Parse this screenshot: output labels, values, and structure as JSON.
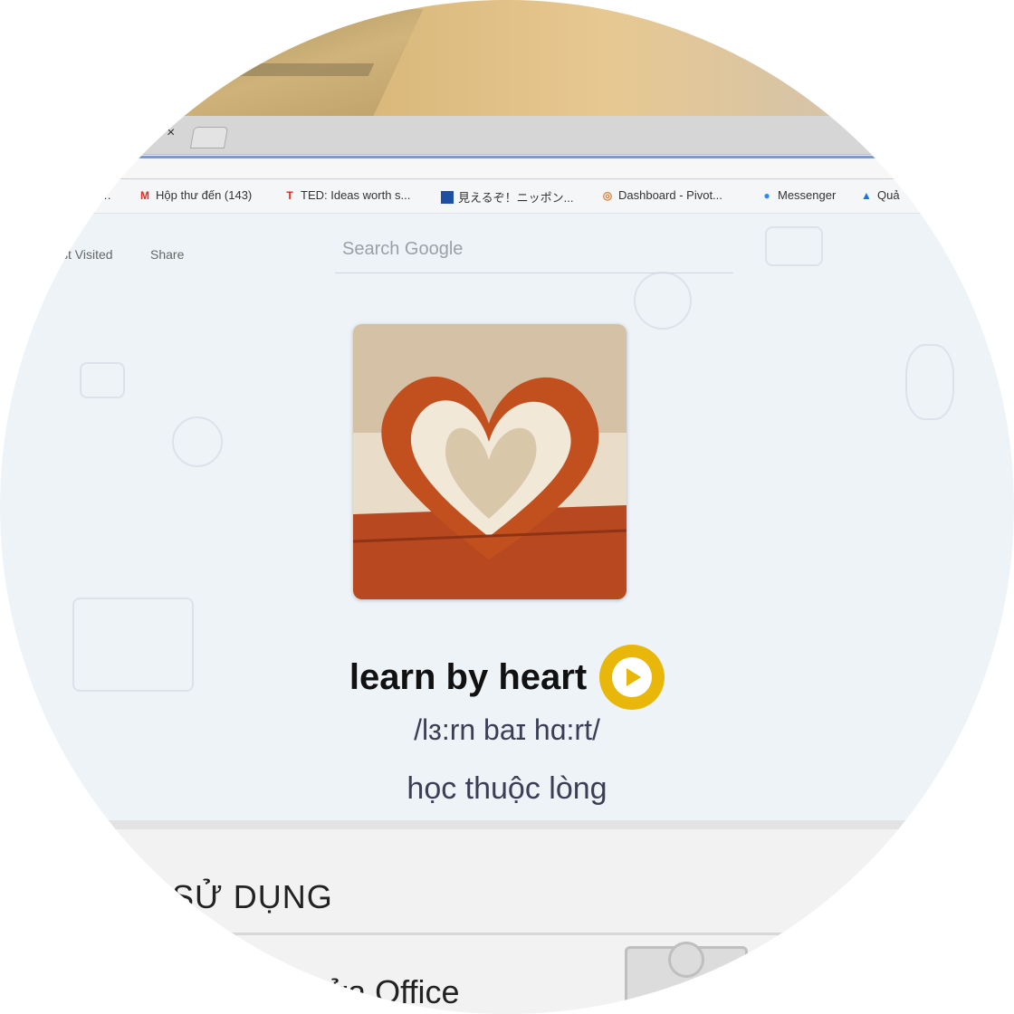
{
  "browser": {
    "tab_close": "×",
    "bookmarks": [
      {
        "label": "Hộp thư đến (143)",
        "icon": "gmail-icon",
        "color": "#d93025"
      },
      {
        "label": "TED: Ideas worth s...",
        "icon": "ted-icon",
        "color": "#e62b1e"
      },
      {
        "label": "見えるぞ！ニッポン...",
        "icon": "flag-icon",
        "color": "#1f4fa3"
      },
      {
        "label": "Dashboard - Pivot...",
        "icon": "pivotal-icon",
        "color": "#e07b2e"
      },
      {
        "label": "Messenger",
        "icon": "messenger-icon",
        "color": "#2d88ff"
      },
      {
        "label": "Quả",
        "icon": "adwords-icon",
        "color": "#1a73e8"
      }
    ]
  },
  "newtab": {
    "most_visited": "st Visited",
    "share": "Share",
    "search_placeholder": "Search Google"
  },
  "flashcard": {
    "word": "learn by heart",
    "ipa": "/lɜ:rn baɪ hɑ:rt/",
    "meaning": "học thuộc lòng",
    "play_color": "#e8b70a"
  },
  "page": {
    "section_title": "SỬ DỤNG",
    "item": "ửa Office"
  }
}
